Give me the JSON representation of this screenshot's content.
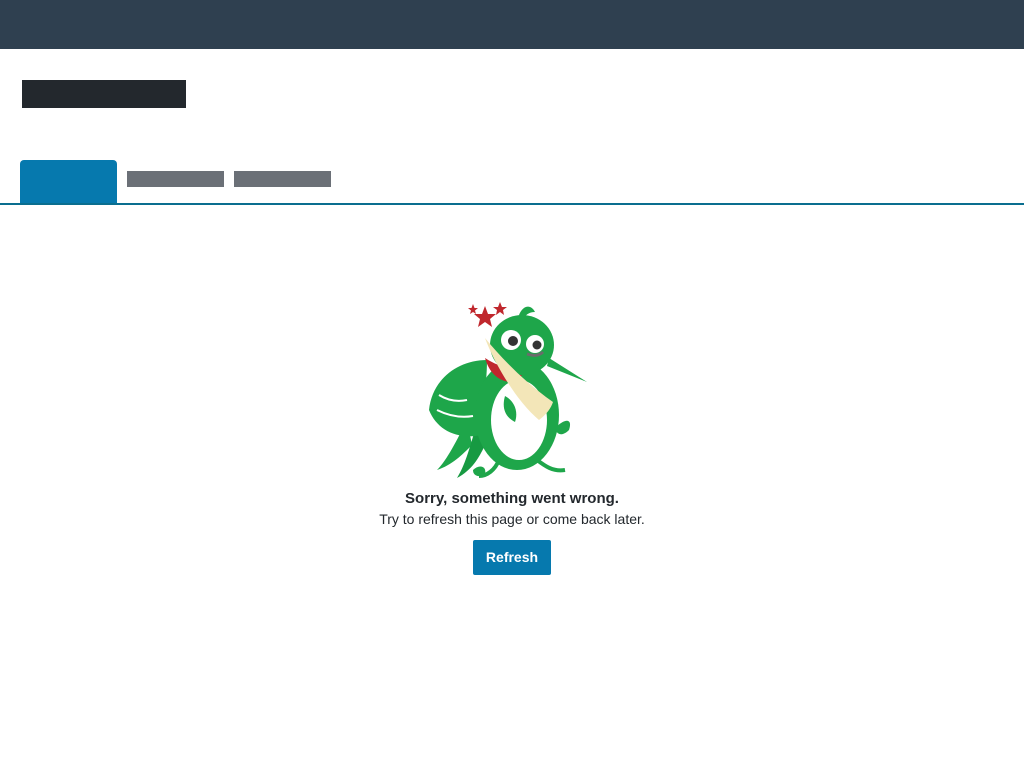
{
  "header": {
    "background_color": "#2f4050"
  },
  "tabs": {
    "active_color": "#0679ae",
    "items": [
      {
        "label": "",
        "state": "active"
      },
      {
        "label": "",
        "state": "inactive"
      },
      {
        "label": "",
        "state": "inactive"
      }
    ]
  },
  "error": {
    "illustration_icon": "dizzy-hummingbird-icon",
    "title": "Sorry, something went wrong.",
    "message": "Try to refresh this page or come back later.",
    "refresh_label": "Refresh"
  },
  "colors": {
    "accent": "#0679ae",
    "bird_green": "#1ea64a",
    "star_red": "#c0272d"
  }
}
